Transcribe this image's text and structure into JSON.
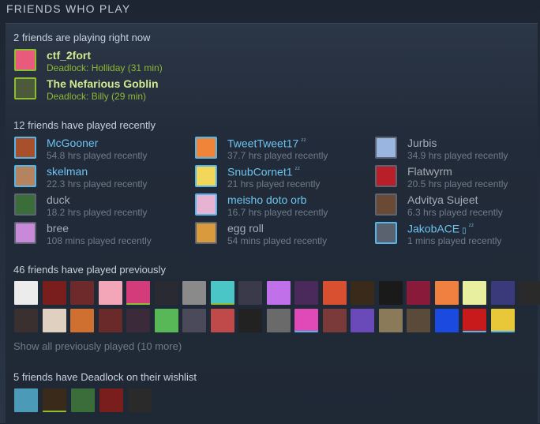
{
  "header": {
    "title": "FRIENDS WHO PLAY"
  },
  "playing": {
    "title": "2 friends are playing right now",
    "friends": [
      {
        "name": "ctf_2fort",
        "status": "Deadlock: Holliday (31 min)",
        "color": "#e85b7c"
      },
      {
        "name": "The Nefarious Goblin",
        "status": "Deadlock: Billy (29 min)",
        "color": "#4d5a3a"
      }
    ]
  },
  "recent": {
    "title": "12 friends have played recently",
    "friends": [
      {
        "name": "McGooner",
        "hours": "54.8 hrs played recently",
        "state": "online",
        "color": "#a8502c"
      },
      {
        "name": "skelman",
        "hours": "22.3 hrs played recently",
        "state": "online",
        "color": "#b48460"
      },
      {
        "name": "duck",
        "hours": "18.2 hrs played recently",
        "state": "offline",
        "color": "#3a6d3a"
      },
      {
        "name": "bree",
        "hours": "108 mins played recently",
        "state": "offline",
        "color": "#c889d8"
      },
      {
        "name": "TweetTweet17",
        "hours": "37.7 hrs played recently",
        "state": "online",
        "icon": "zz",
        "color": "#f0853a"
      },
      {
        "name": "SnubCornet1",
        "hours": "21 hrs played recently",
        "state": "online",
        "icon": "zz",
        "color": "#f1d85a"
      },
      {
        "name": "meisho doto orb",
        "hours": "16.7 hrs played recently",
        "state": "online",
        "color": "#e6b4d2"
      },
      {
        "name": "egg roll",
        "hours": "54 mins played recently",
        "state": "offline",
        "color": "#d89a3c"
      },
      {
        "name": "Jurbis",
        "hours": "34.9 hrs played recently",
        "state": "offline",
        "color": "#9ab6e0"
      },
      {
        "name": "Flatwyrm",
        "hours": "20.5 hrs played recently",
        "state": "offline",
        "color": "#b81f28"
      },
      {
        "name": "Advitya Sujeet",
        "hours": "6.3 hrs played recently",
        "state": "offline",
        "color": "#6a4a34"
      },
      {
        "name": "JakobACE",
        "hours": "1 mins played recently",
        "state": "online",
        "icon": "phone-zz",
        "color": "#5a6270"
      }
    ]
  },
  "previous": {
    "title": "46 friends have played previously",
    "show_all": "Show all previously played (10 more)",
    "row1": [
      "#ececec",
      "#7a1d1d",
      "#6e2a2a",
      "#f2a6b8",
      "#d43b7a",
      "#2a2a32",
      "#8a8a8a",
      "#4ac6c6",
      "#3a3a4a",
      "#c070e8",
      "#4a2a5a",
      "#d85030",
      "#3a2a1a",
      "#1a1a1a",
      "#8a1a3a",
      "#f08040",
      "#e8f0a0",
      "#3a3a7a",
      "#2a2a2a"
    ],
    "row1_border": [
      "none",
      "none",
      "none",
      "none",
      "green",
      "none",
      "none",
      "green",
      "none",
      "none",
      "none",
      "none",
      "none",
      "none",
      "none",
      "none",
      "none",
      "none",
      "none"
    ],
    "row2": [
      "#3a3030",
      "#e0d0c0",
      "#d07030",
      "#6a2a2a",
      "#3a2a3a",
      "#58b858",
      "#4a4a5a",
      "#c04a4a",
      "#222222",
      "#6a6a6a",
      "#e04ab8",
      "#7a3a3a",
      "#6a4ab8",
      "#8a7a5a",
      "#5a4a3a",
      "#1a4ae0",
      "#c81a1a",
      "#e8c838"
    ],
    "row2_border": [
      "none",
      "none",
      "none",
      "none",
      "none",
      "none",
      "none",
      "none",
      "none",
      "none",
      "blue",
      "none",
      "none",
      "none",
      "none",
      "none",
      "blue",
      "blue"
    ]
  },
  "wishlist": {
    "title": "5 friends have Deadlock on their wishlist",
    "avatars": [
      "#4a9ab8",
      "#3a2a1a",
      "#3a6d3a",
      "#7a1d1d",
      "#2a2a2a"
    ],
    "borders": [
      "none",
      "green",
      "none",
      "none",
      "none"
    ]
  }
}
